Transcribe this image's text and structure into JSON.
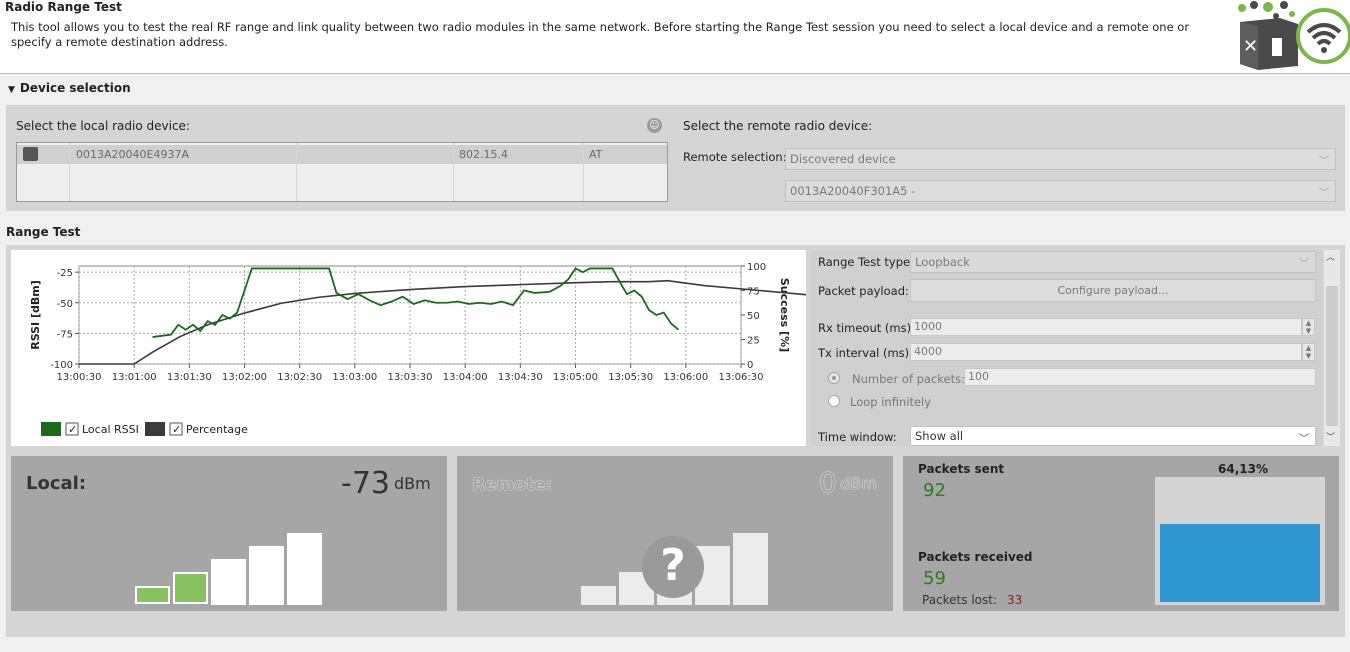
{
  "header": {
    "title": "Radio Range Test",
    "description": "This tool allows you to test the real RF range and link quality between two radio modules in the same network. Before starting the Range Test session you need to select a local device and a remote one or specify a remote destination address."
  },
  "device_selection": {
    "header": "Device selection",
    "local_label": "Select the local radio device:",
    "local_devices": [
      {
        "address": "0013A20040E4937A",
        "protocol": "802.15.4",
        "mode": "AT"
      }
    ],
    "remote_label": "Select the remote radio device:",
    "remote_selection_label": "Remote selection:",
    "remote_selection_value": "Discovered device",
    "remote_device_value": "0013A20040F301A5 -"
  },
  "range_test": {
    "header": "Range Test",
    "type_label": "Range Test type:",
    "type_value": "Loopback",
    "payload_label": "Packet payload:",
    "payload_button": "Configure payload...",
    "rx_timeout_label": "Rx timeout (ms):",
    "rx_timeout_value": "1000",
    "tx_interval_label": "Tx interval (ms):",
    "tx_interval_value": "4000",
    "num_packets_label": "Number of packets:",
    "num_packets_value": "100",
    "loop_label": "Loop infinitely",
    "time_window_label": "Time window:",
    "time_window_value": "Show all"
  },
  "chart_data": {
    "type": "line",
    "ylabel": "RSSI [dBm]",
    "y2label": "Success [%]",
    "ylim": [
      -100,
      -20
    ],
    "y2lim": [
      0,
      100
    ],
    "yticks": [
      "-25",
      "-50",
      "-75",
      "-100"
    ],
    "y2ticks": [
      "100",
      "75",
      "50",
      "25",
      "0"
    ],
    "xticks": [
      "13:00:30",
      "13:01:00",
      "13:01:30",
      "13:02:00",
      "13:02:30",
      "13:03:00",
      "13:03:30",
      "13:04:00",
      "13:04:30",
      "13:05:00",
      "13:05:30",
      "13:06:00",
      "13:06:30"
    ],
    "grid": true,
    "legend_position": "bottom-left",
    "series": [
      {
        "name": "Local RSSI",
        "color": "#1a6b1a",
        "x_seconds": [
          40,
          45,
          50,
          54,
          58,
          62,
          66,
          70,
          74,
          78,
          82,
          86,
          90,
          94,
          100,
          112,
          124,
          136,
          140,
          146,
          152,
          158,
          164,
          170,
          176,
          182,
          188,
          194,
          200,
          206,
          212,
          218,
          224,
          230,
          236,
          242,
          248,
          256,
          262,
          266,
          270,
          274,
          278,
          284,
          290,
          296,
          298,
          302,
          306,
          310,
          314,
          318,
          322,
          326
        ],
        "values": [
          -78,
          -77,
          -76,
          -68,
          -72,
          -68,
          -73,
          -65,
          -68,
          -60,
          -63,
          -58,
          -40,
          -22,
          -22,
          -22,
          -22,
          -22,
          -42,
          -47,
          -43,
          -48,
          -52,
          -49,
          -45,
          -51,
          -48,
          -50,
          -50,
          -49,
          -51,
          -50,
          -51,
          -49,
          -52,
          -40,
          -42,
          -41,
          -36,
          -31,
          -22,
          -25,
          -22,
          -22,
          -22,
          -38,
          -43,
          -40,
          -45,
          -56,
          -60,
          -58,
          -67,
          -72
        ]
      },
      {
        "name": "Percentage",
        "color": "#3a3a3a",
        "x_seconds": [
          0,
          10,
          20,
          30,
          40,
          55,
          70,
          90,
          110,
          130,
          150,
          180,
          210,
          240,
          270,
          290,
          300,
          310,
          320,
          340,
          370,
          400,
          430,
          440
        ],
        "values": [
          0,
          0,
          0,
          0,
          12,
          28,
          40,
          52,
          62,
          68,
          72,
          76,
          79,
          81,
          83,
          84,
          84,
          84,
          85,
          80,
          75,
          70,
          67,
          66
        ]
      }
    ]
  },
  "legend": {
    "local_rssi": "Local RSSI",
    "percentage": "Percentage"
  },
  "local_panel": {
    "title": "Local:",
    "value": "-73",
    "unit": "dBm",
    "bars_active": 2
  },
  "remote_panel": {
    "title": "Remote:",
    "value": "0",
    "unit": "dBm",
    "question": "?"
  },
  "packets": {
    "sent_label": "Packets sent",
    "sent_value": "92",
    "received_label": "Packets received",
    "received_value": "59",
    "lost_label": "Packets lost:",
    "lost_value": "33",
    "percent_label": "64,13%",
    "percent": 0.6413
  }
}
